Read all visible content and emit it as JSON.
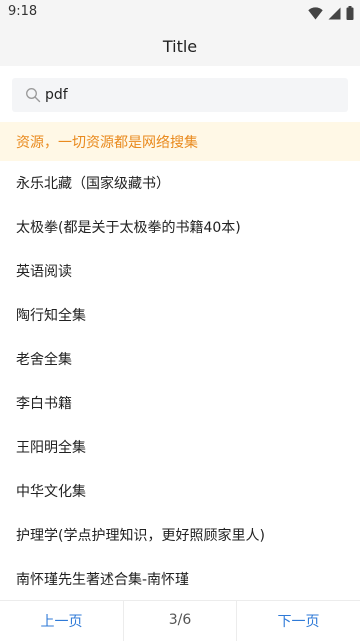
{
  "status_bar": {
    "time": "9:18",
    "icons": [
      "wifi-icon",
      "signal-icon",
      "battery-icon"
    ]
  },
  "app_bar": {
    "title": "Title"
  },
  "search": {
    "value": "pdf",
    "icon": "search-icon"
  },
  "notice": {
    "text": "资源，一切资源都是网络搜集"
  },
  "list": {
    "items": [
      "永乐北藏（国家级藏书）",
      "太极拳(都是关于太极拳的书籍40本)",
      "英语阅读",
      "陶行知全集",
      "老舍全集",
      "李白书籍",
      "王阳明全集",
      "中华文化集",
      "护理学(学点护理知识，更好照顾家里人)",
      "南怀瑾先生著述合集-南怀瑾"
    ]
  },
  "pager": {
    "prev_label": "上一页",
    "page_info": "3/6",
    "next_label": "下一页"
  },
  "colors": {
    "notice_text": "#e98a1e",
    "notice_bg": "#fff8e6",
    "link": "#2f7ad7"
  }
}
